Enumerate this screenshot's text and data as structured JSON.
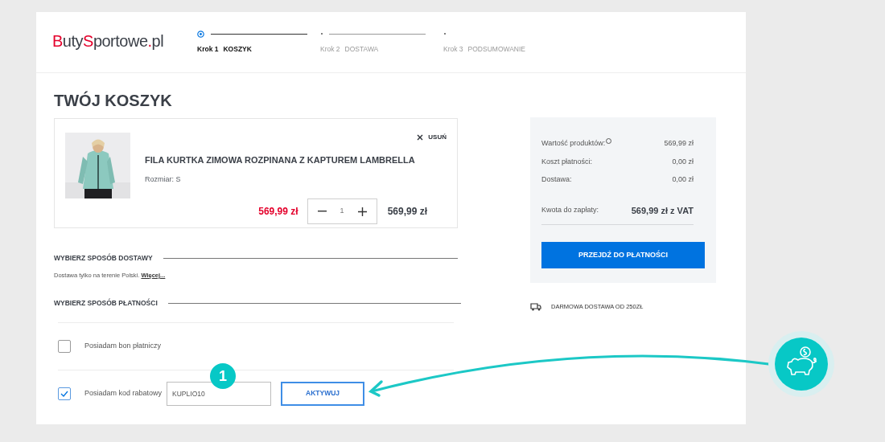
{
  "logo": [
    {
      "text": "B",
      "kind": "accent"
    },
    {
      "text": "uty",
      "kind": "plain"
    },
    {
      "text": "S",
      "kind": "accent"
    },
    {
      "text": "portowe",
      "kind": "plain"
    },
    {
      "text": ".",
      "kind": "accent"
    },
    {
      "text": "pl",
      "kind": "plain"
    }
  ],
  "steps": [
    {
      "number": "Krok 1",
      "label": "KOSZYK",
      "selected": true
    },
    {
      "number": "Krok 2",
      "label": "DOSTAWA",
      "selected": false
    },
    {
      "number": "Krok 3",
      "label": "PODSUMOWANIE",
      "selected": false
    }
  ],
  "title": "TWÓJ KOSZYK",
  "cart_item": {
    "remove": "USUŃ",
    "name": "FILA KURTKA ZIMOWA ROZPINANA Z KAPTUREM LAMBRELLA",
    "size": "Rozmiar: S",
    "price": "569,99 zł",
    "quantity": "1",
    "total": "569,99 zł"
  },
  "delivery": {
    "heading": "WYBIERZ SPOSÓB DOSTAWY",
    "note": "Dostawa tylko na terenie Polski.",
    "link": "Więcej..."
  },
  "payment": {
    "heading": "WYBIERZ SPOSÓB PŁATNOŚCI",
    "options": [
      {
        "kind": "plain",
        "label": "Posiadam bon płatniczy",
        "checked": false
      },
      {
        "kind": "code",
        "label": "Posiadam kod rabatowy",
        "checked": true,
        "value": "KUPLIO10",
        "button": "AKTYWUJ"
      }
    ]
  },
  "summary": {
    "rows": [
      {
        "label": "Wartość produktów:",
        "value": "569,99 zł",
        "help": true
      },
      {
        "label": "Koszt płatności:",
        "value": "0,00 zł",
        "help": false
      },
      {
        "label": "Dostawa:",
        "value": "0,00 zł",
        "help": false
      }
    ],
    "total_label": "Kwota do zapłaty:",
    "total_value": "569,99 zł z VAT",
    "button": "PRZEJDŹ DO PŁATNOŚCI"
  },
  "free_delivery": "DARMOWA DOSTAWA OD 250ZŁ",
  "annotation": {
    "badge": "1"
  }
}
